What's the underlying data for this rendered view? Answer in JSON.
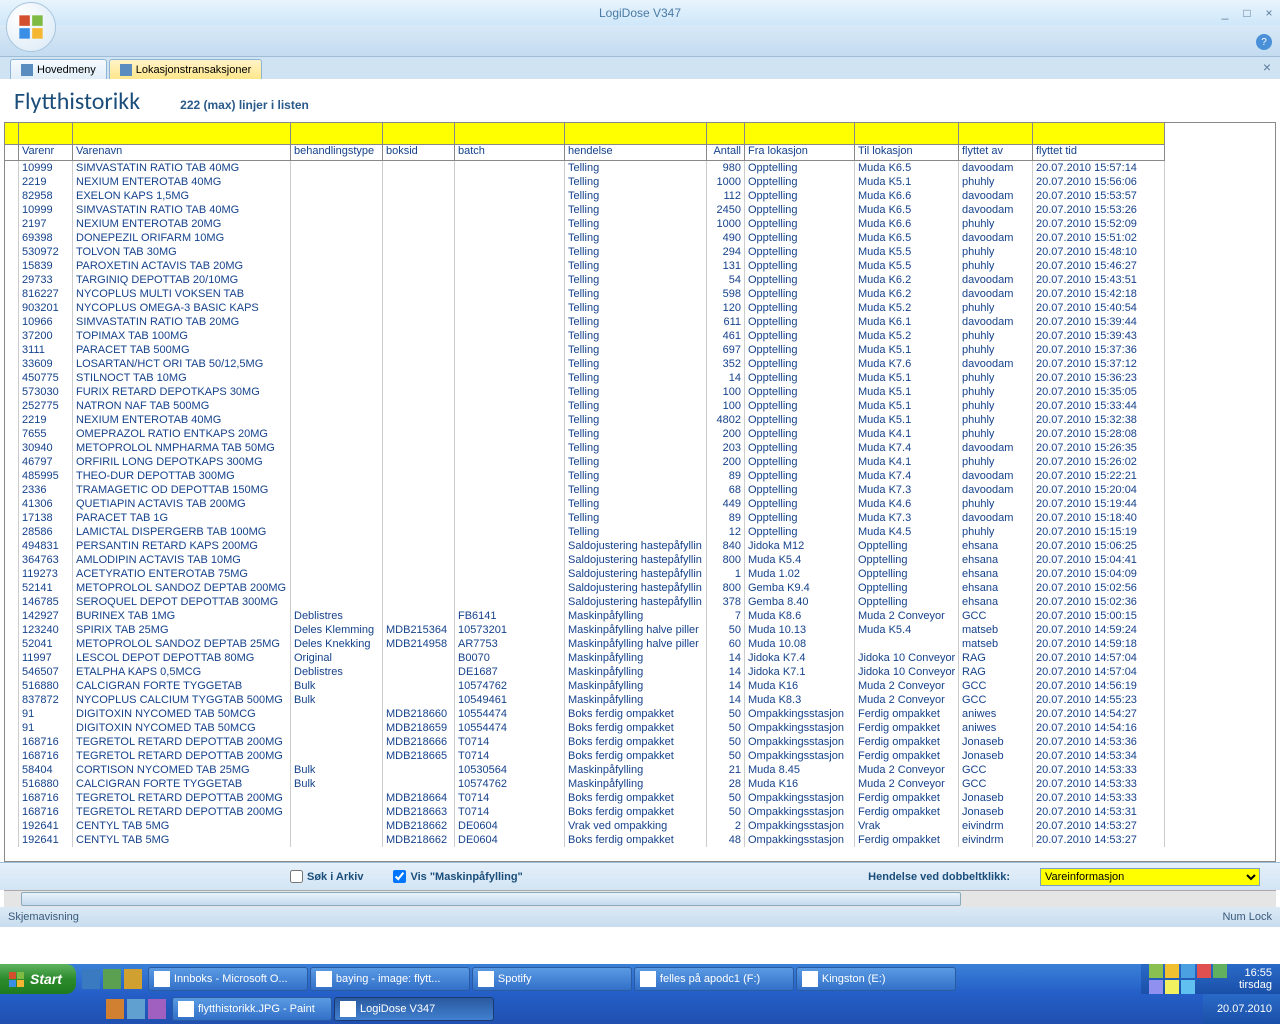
{
  "app": {
    "title": "LogiDose V347"
  },
  "tabs": [
    {
      "label": "Hovedmeny",
      "active": false
    },
    {
      "label": "Lokasjonstransaksjoner",
      "active": true
    }
  ],
  "page": {
    "heading": "Flytthistorikk",
    "subtitle": "222 (max) linjer i listen"
  },
  "columns": [
    "",
    "Varenr",
    "Varenavn",
    "behandlingstype",
    "boksid",
    "batch",
    "hendelse",
    "Antall",
    "Fra lokasjon",
    "Til lokasjon",
    "flyttet av",
    "flyttet tid"
  ],
  "rows": [
    [
      "",
      "10999",
      "SIMVASTATIN RATIO TAB 40MG",
      "",
      "",
      "",
      "Telling",
      "980",
      "Opptelling",
      "Muda K6.5",
      "davoodam",
      "20.07.2010 15:57:14"
    ],
    [
      "",
      "2219",
      "NEXIUM ENTEROTAB 40MG",
      "",
      "",
      "",
      "Telling",
      "1000",
      "Opptelling",
      "Muda K5.1",
      "phuhly",
      "20.07.2010 15:56:06"
    ],
    [
      "",
      "82958",
      "EXELON KAPS 1,5MG",
      "",
      "",
      "",
      "Telling",
      "112",
      "Opptelling",
      "Muda K6.6",
      "davoodam",
      "20.07.2010 15:53:57"
    ],
    [
      "",
      "10999",
      "SIMVASTATIN RATIO TAB 40MG",
      "",
      "",
      "",
      "Telling",
      "2450",
      "Opptelling",
      "Muda K6.5",
      "davoodam",
      "20.07.2010 15:53:26"
    ],
    [
      "",
      "2197",
      "NEXIUM ENTEROTAB 20MG",
      "",
      "",
      "",
      "Telling",
      "1000",
      "Opptelling",
      "Muda K6.6",
      "phuhly",
      "20.07.2010 15:52:09"
    ],
    [
      "",
      "69398",
      "DONEPEZIL ORIFARM 10MG",
      "",
      "",
      "",
      "Telling",
      "490",
      "Opptelling",
      "Muda K6.5",
      "davoodam",
      "20.07.2010 15:51:02"
    ],
    [
      "",
      "530972",
      "TOLVON TAB 30MG",
      "",
      "",
      "",
      "Telling",
      "294",
      "Opptelling",
      "Muda K5.5",
      "phuhly",
      "20.07.2010 15:48:10"
    ],
    [
      "",
      "15839",
      "PAROXETIN ACTAVIS TAB 20MG",
      "",
      "",
      "",
      "Telling",
      "131",
      "Opptelling",
      "Muda K5.5",
      "phuhly",
      "20.07.2010 15:46:27"
    ],
    [
      "",
      "29733",
      "TARGINIQ DEPOTTAB 20/10MG",
      "",
      "",
      "",
      "Telling",
      "54",
      "Opptelling",
      "Muda K6.2",
      "davoodam",
      "20.07.2010 15:43:51"
    ],
    [
      "",
      "816227",
      "NYCOPLUS MULTI VOKSEN TAB",
      "",
      "",
      "",
      "Telling",
      "598",
      "Opptelling",
      "Muda K6.2",
      "davoodam",
      "20.07.2010 15:42:18"
    ],
    [
      "",
      "903201",
      "NYCOPLUS OMEGA-3 BASIC KAPS",
      "",
      "",
      "",
      "Telling",
      "120",
      "Opptelling",
      "Muda K5.2",
      "phuhly",
      "20.07.2010 15:40:54"
    ],
    [
      "",
      "10966",
      "SIMVASTATIN RATIO TAB 20MG",
      "",
      "",
      "",
      "Telling",
      "611",
      "Opptelling",
      "Muda K6.1",
      "davoodam",
      "20.07.2010 15:39:44"
    ],
    [
      "",
      "37200",
      "TOPIMAX TAB 100MG",
      "",
      "",
      "",
      "Telling",
      "461",
      "Opptelling",
      "Muda K5.2",
      "phuhly",
      "20.07.2010 15:39:43"
    ],
    [
      "",
      "3111",
      "PARACET TAB  500MG",
      "",
      "",
      "",
      "Telling",
      "697",
      "Opptelling",
      "Muda K5.1",
      "phuhly",
      "20.07.2010 15:37:36"
    ],
    [
      "",
      "33609",
      "LOSARTAN/HCT ORI TAB 50/12,5MG",
      "",
      "",
      "",
      "Telling",
      "352",
      "Opptelling",
      "Muda K7.6",
      "davoodam",
      "20.07.2010 15:37:12"
    ],
    [
      "",
      "450775",
      "STILNOCT TAB 10MG",
      "",
      "",
      "",
      "Telling",
      "14",
      "Opptelling",
      "Muda K5.1",
      "phuhly",
      "20.07.2010 15:36:23"
    ],
    [
      "",
      "573030",
      "FURIX RETARD DEPOTKAPS 30MG",
      "",
      "",
      "",
      "Telling",
      "100",
      "Opptelling",
      "Muda K5.1",
      "phuhly",
      "20.07.2010 15:35:05"
    ],
    [
      "",
      "252775",
      "NATRON NAF TAB 500MG",
      "",
      "",
      "",
      "Telling",
      "100",
      "Opptelling",
      "Muda K5.1",
      "phuhly",
      "20.07.2010 15:33:44"
    ],
    [
      "",
      "2219",
      "NEXIUM ENTEROTAB 40MG",
      "",
      "",
      "",
      "Telling",
      "4802",
      "Opptelling",
      "Muda K5.1",
      "phuhly",
      "20.07.2010 15:32:38"
    ],
    [
      "",
      "7655",
      "OMEPRAZOL RATIO ENTKAPS 20MG",
      "",
      "",
      "",
      "Telling",
      "200",
      "Opptelling",
      "Muda K4.1",
      "phuhly",
      "20.07.2010 15:28:08"
    ],
    [
      "",
      "30940",
      "METOPROLOL NMPHARMA TAB  50MG",
      "",
      "",
      "",
      "Telling",
      "203",
      "Opptelling",
      "Muda K7.4",
      "davoodam",
      "20.07.2010 15:26:35"
    ],
    [
      "",
      "46797",
      "ORFIRIL LONG DEPOTKAPS 300MG",
      "",
      "",
      "",
      "Telling",
      "200",
      "Opptelling",
      "Muda K4.1",
      "phuhly",
      "20.07.2010 15:26:02"
    ],
    [
      "",
      "485995",
      "THEO-DUR DEPOTTAB 300MG",
      "",
      "",
      "",
      "Telling",
      "89",
      "Opptelling",
      "Muda K7.4",
      "davoodam",
      "20.07.2010 15:22:21"
    ],
    [
      "",
      "2336",
      "TRAMAGETIC OD DEPOTTAB 150MG",
      "",
      "",
      "",
      "Telling",
      "68",
      "Opptelling",
      "Muda K7.3",
      "davoodam",
      "20.07.2010 15:20:04"
    ],
    [
      "",
      "41306",
      "QUETIAPIN ACTAVIS TAB 200MG",
      "",
      "",
      "",
      "Telling",
      "449",
      "Opptelling",
      "Muda K4.6",
      "phuhly",
      "20.07.2010 15:19:44"
    ],
    [
      "",
      "17138",
      "PARACET TAB 1G",
      "",
      "",
      "",
      "Telling",
      "89",
      "Opptelling",
      "Muda K7.3",
      "davoodam",
      "20.07.2010 15:18:40"
    ],
    [
      "",
      "28586",
      "LAMICTAL DISPERGERB TAB 100MG",
      "",
      "",
      "",
      "Telling",
      "12",
      "Opptelling",
      "Muda K4.5",
      "phuhly",
      "20.07.2010 15:15:19"
    ],
    [
      "",
      "494831",
      "PERSANTIN RETARD KAPS 200MG",
      "",
      "",
      "",
      "Saldojustering hastepåfyllin",
      "840",
      "Jidoka M12",
      "Opptelling",
      "ehsana",
      "20.07.2010 15:06:25"
    ],
    [
      "",
      "364763",
      "AMLODIPIN ACTAVIS TAB 10MG",
      "",
      "",
      "",
      "Saldojustering hastepåfyllin",
      "800",
      "Muda K5.4",
      "Opptelling",
      "ehsana",
      "20.07.2010 15:04:41"
    ],
    [
      "",
      "119273",
      "ACETYRATIO ENTEROTAB 75MG",
      "",
      "",
      "",
      "Saldojustering hastepåfyllin",
      "1",
      "Muda 1.02",
      "Opptelling",
      "ehsana",
      "20.07.2010 15:04:09"
    ],
    [
      "",
      "52141",
      "METOPROLOL SANDOZ DEPTAB 200MG",
      "",
      "",
      "",
      "Saldojustering hastepåfyllin",
      "800",
      "Gemba K9.4",
      "Opptelling",
      "ehsana",
      "20.07.2010 15:02:56"
    ],
    [
      "",
      "146785",
      "SEROQUEL DEPOT DEPOTTAB 300MG",
      "",
      "",
      "",
      "Saldojustering hastepåfyllin",
      "378",
      "Gemba 8.40",
      "Opptelling",
      "ehsana",
      "20.07.2010 15:02:36"
    ],
    [
      "",
      "142927",
      "BURINEX TAB 1MG",
      "Deblistres",
      "",
      "FB6141",
      "Maskinpåfylling",
      "7",
      "Muda K8.6",
      "Muda 2 Conveyor",
      "GCC",
      "20.07.2010 15:00:15"
    ],
    [
      "",
      "123240",
      "SPIRIX TAB  25MG",
      "Deles Klemming",
      "MDB215364",
      "10573201",
      "Maskinpåfylling halve piller",
      "50",
      "Muda 10.13",
      "Muda K5.4",
      "matseb",
      "20.07.2010 14:59:24"
    ],
    [
      "",
      "52041",
      "METOPROLOL SANDOZ DEPTAB  25MG",
      "Deles Knekking",
      "MDB214958",
      "AR7753",
      "Maskinpåfylling halve piller",
      "60",
      "Muda 10.08",
      "",
      "matseb",
      "20.07.2010 14:59:18"
    ],
    [
      "",
      "11997",
      "LESCOL DEPOT DEPOTTAB 80MG",
      "Original",
      "",
      "B0070",
      "Maskinpåfylling",
      "14",
      "Jidoka K7.4",
      "Jidoka 10 Conveyor",
      "RAG",
      "20.07.2010 14:57:04"
    ],
    [
      "",
      "546507",
      "ETALPHA KAPS 0,5MCG",
      "Deblistres",
      "",
      "DE1687",
      "Maskinpåfylling",
      "14",
      "Jidoka K7.1",
      "Jidoka 10 Conveyor",
      "RAG",
      "20.07.2010 14:57:04"
    ],
    [
      "",
      "516880",
      "CALCIGRAN FORTE TYGGETAB",
      "Bulk",
      "",
      "10574762",
      "Maskinpåfylling",
      "14",
      "Muda K16",
      "Muda 2 Conveyor",
      "GCC",
      "20.07.2010 14:56:19"
    ],
    [
      "",
      "837872",
      "NYCOPLUS CALCIUM TYGGTAB 500MG",
      "Bulk",
      "",
      "10549461",
      "Maskinpåfylling",
      "14",
      "Muda K8.3",
      "Muda 2 Conveyor",
      "GCC",
      "20.07.2010 14:55:23"
    ],
    [
      "",
      "91",
      "DIGITOXIN NYCOMED TAB 50MCG",
      "",
      "MDB218660",
      "10554474",
      "Boks ferdig ompakket",
      "50",
      "Ompakkingsstasjon",
      "Ferdig ompakket",
      "aniwes",
      "20.07.2010 14:54:27"
    ],
    [
      "",
      "91",
      "DIGITOXIN NYCOMED TAB 50MCG",
      "",
      "MDB218659",
      "10554474",
      "Boks ferdig ompakket",
      "50",
      "Ompakkingsstasjon",
      "Ferdig ompakket",
      "aniwes",
      "20.07.2010 14:54:16"
    ],
    [
      "",
      "168716",
      "TEGRETOL RETARD DEPOTTAB 200MG",
      "",
      "MDB218666",
      "T0714",
      "Boks ferdig ompakket",
      "50",
      "Ompakkingsstasjon",
      "Ferdig ompakket",
      "Jonaseb",
      "20.07.2010 14:53:36"
    ],
    [
      "",
      "168716",
      "TEGRETOL RETARD DEPOTTAB 200MG",
      "",
      "MDB218665",
      "T0714",
      "Boks ferdig ompakket",
      "50",
      "Ompakkingsstasjon",
      "Ferdig ompakket",
      "Jonaseb",
      "20.07.2010 14:53:34"
    ],
    [
      "",
      "58404",
      "CORTISON NYCOMED TAB 25MG",
      "Bulk",
      "",
      "10530564",
      "Maskinpåfylling",
      "21",
      "Muda 8.45",
      "Muda 2 Conveyor",
      "GCC",
      "20.07.2010 14:53:33"
    ],
    [
      "",
      "516880",
      "CALCIGRAN FORTE TYGGETAB",
      "Bulk",
      "",
      "10574762",
      "Maskinpåfylling",
      "28",
      "Muda K16",
      "Muda 2 Conveyor",
      "GCC",
      "20.07.2010 14:53:33"
    ],
    [
      "",
      "168716",
      "TEGRETOL RETARD DEPOTTAB 200MG",
      "",
      "MDB218664",
      "T0714",
      "Boks ferdig ompakket",
      "50",
      "Ompakkingsstasjon",
      "Ferdig ompakket",
      "Jonaseb",
      "20.07.2010 14:53:33"
    ],
    [
      "",
      "168716",
      "TEGRETOL RETARD DEPOTTAB 200MG",
      "",
      "MDB218663",
      "T0714",
      "Boks ferdig ompakket",
      "50",
      "Ompakkingsstasjon",
      "Ferdig ompakket",
      "Jonaseb",
      "20.07.2010 14:53:31"
    ],
    [
      "",
      "192641",
      "CENTYL TAB 5MG",
      "",
      "MDB218662",
      "DE0604",
      "Vrak ved ompakking",
      "2",
      "Ompakkingsstasjon",
      "Vrak",
      "eivindrm",
      "20.07.2010 14:53:27"
    ],
    [
      "",
      "192641",
      "CENTYL TAB 5MG",
      "",
      "MDB218662",
      "DE0604",
      "Boks ferdig ompakket",
      "48",
      "Ompakkingsstasjon",
      "Ferdig ompakket",
      "eivindrm",
      "20.07.2010 14:53:27"
    ]
  ],
  "controls": {
    "archive": "Søk i Arkiv",
    "show_fill": "Vis \"Maskinpåfylling\"",
    "dblclick_label": "Hendelse ved dobbeltklikk:",
    "dblclick_value": "Vareinformasjon"
  },
  "statusbar": {
    "left": "Skjemavisning",
    "right": "Num Lock"
  },
  "taskbar": {
    "start": "Start",
    "row1": [
      "Innboks - Microsoft O...",
      "baying - image: flytt...",
      "Spotify",
      "felles på apodc1 (F:)",
      "Kingston (E:)"
    ],
    "row2": [
      "flytthistorikk.JPG - Paint",
      "LogiDose V347"
    ],
    "clock": {
      "time": "16:55",
      "day": "tirsdag",
      "date": "20.07.2010"
    }
  }
}
